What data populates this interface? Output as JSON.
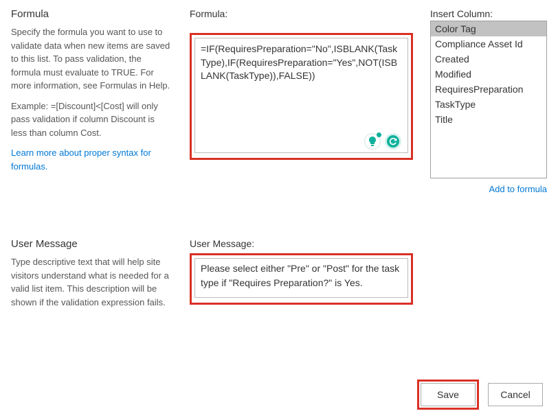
{
  "formula_section": {
    "heading": "Formula",
    "description": "Specify the formula you want to use to validate data when new items are saved to this list. To pass validation, the formula must evaluate to TRUE. For more information, see Formulas in Help.",
    "example": "Example: =[Discount]<[Cost] will only pass validation if column Discount is less than column Cost.",
    "link_text": "Learn more about proper syntax for formulas."
  },
  "formula_field": {
    "label": "Formula:",
    "value": "=IF(RequiresPreparation=\"No\",ISBLANK(TaskType),IF(RequiresPreparation=\"Yes\",NOT(ISBLANK(TaskType)),FALSE))"
  },
  "insert_column": {
    "label": "Insert Column:",
    "items": [
      "Color Tag",
      "Compliance Asset Id",
      "Created",
      "Modified",
      "RequiresPreparation",
      "TaskType",
      "Title"
    ],
    "selected_index": 0,
    "add_link": "Add to formula"
  },
  "user_message_section": {
    "heading": "User Message",
    "description": "Type descriptive text that will help site visitors understand what is needed for a valid list item. This description will be shown if the validation expression fails."
  },
  "user_message_field": {
    "label": "User Message:",
    "value": "Please select either \"Pre\" or \"Post\" for the task type if \"Requires Preparation?\" is Yes."
  },
  "buttons": {
    "save": "Save",
    "cancel": "Cancel"
  }
}
